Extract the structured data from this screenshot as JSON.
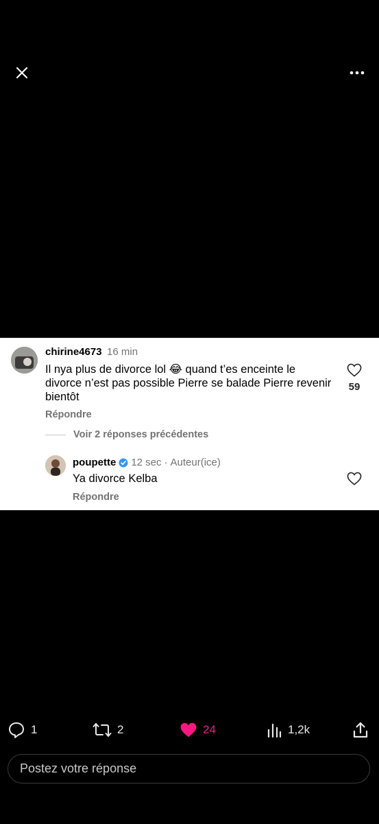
{
  "top_bar": {
    "close_icon": "close-icon",
    "more_icon": "more-horizontal-icon"
  },
  "comment_1": {
    "username": "chirine4673",
    "time": "16 min",
    "text": "Il nya plus de divorce lol 😂 quand t’es enceinte le divorce n’est pas possible Pierre se balade Pierre revenir bientôt",
    "like_count": "59",
    "reply_label": "Répondre"
  },
  "view_previous": "Voir 2 réponses précédentes",
  "comment_2": {
    "username": "poupette",
    "time": "12 sec",
    "author_tag": "Auteur(ice)",
    "text": "Ya divorce Kelba",
    "reply_label": "Répondre",
    "verified_color": "#3897f0"
  },
  "actions": {
    "replies": "1",
    "reposts": "2",
    "likes": "24",
    "views": "1,2k"
  },
  "like_color": "#f91880",
  "reply_box": {
    "placeholder": "Postez votre réponse"
  }
}
